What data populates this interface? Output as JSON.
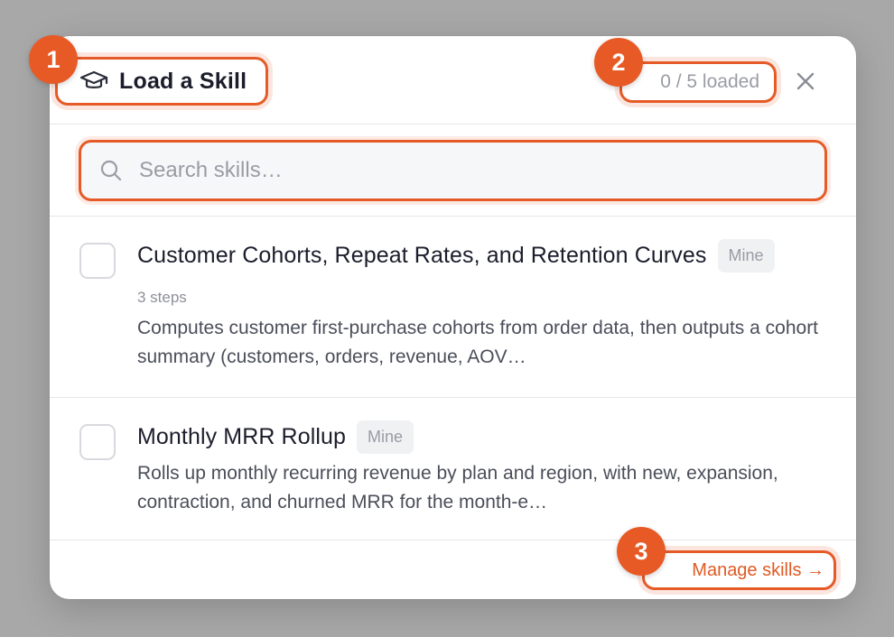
{
  "header": {
    "title": "Load a Skill",
    "loaded_status": "0 / 5 loaded",
    "close_icon": "close-icon",
    "title_icon": "graduation-cap-icon"
  },
  "search": {
    "placeholder": "Search skills…",
    "value": "",
    "icon": "search-icon"
  },
  "skills": [
    {
      "title": "Customer Cohorts, Repeat Rates, and Retention Curves",
      "badge": "Mine",
      "steps": "3 steps",
      "description": "Computes customer first-purchase cohorts from order data, then outputs a cohort summary (customers, orders, revenue, AOV…",
      "checked": false
    },
    {
      "title": "Monthly MRR Rollup",
      "badge": "Mine",
      "description": "Rolls up monthly recurring revenue by plan and region, with new, expansion, contraction, and churned MRR for the month-e…",
      "checked": false
    }
  ],
  "footer": {
    "manage_label": "Manage skills →"
  },
  "markers": [
    "1",
    "2",
    "3"
  ],
  "colors": {
    "accent": "#e55a27",
    "backdrop": "#a8a8a8",
    "text_primary": "#1b1d2b",
    "text_muted": "#9a9ca5"
  }
}
